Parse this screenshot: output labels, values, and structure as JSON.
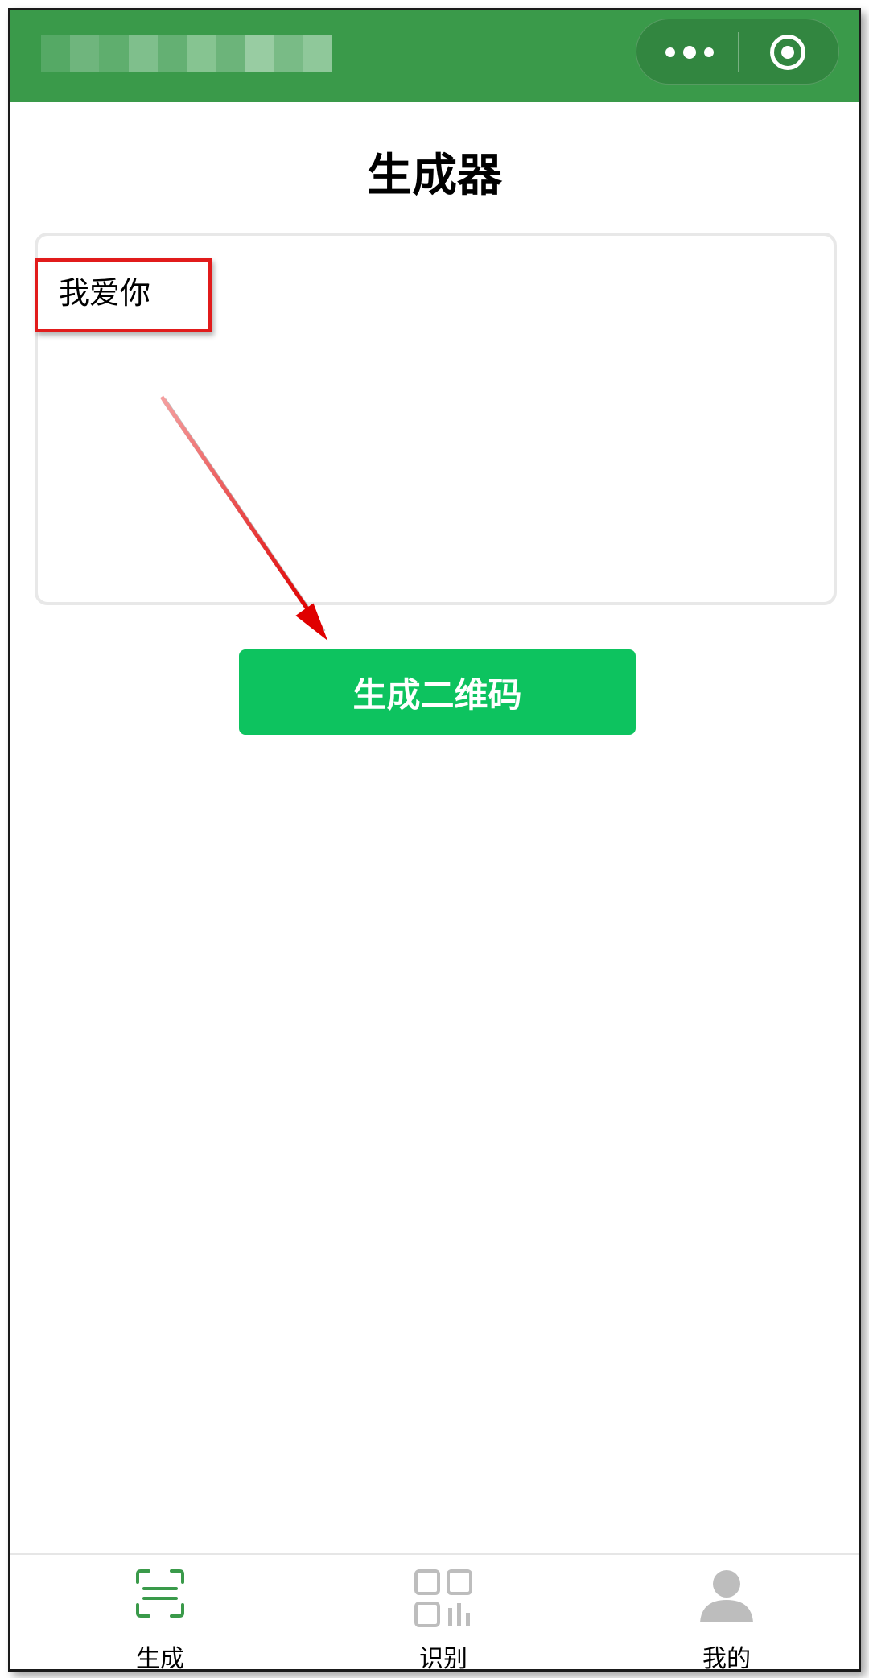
{
  "navbar": {
    "title_blurred": "",
    "more_icon": "more-dots-icon",
    "close_icon": "target-close-icon",
    "accent_color": "#3a9a4a"
  },
  "page": {
    "title": "生成器"
  },
  "input": {
    "value": "我爱你"
  },
  "generate_button": {
    "label": "生成二维码",
    "color": "#0dc35f"
  },
  "tabbar": {
    "items": [
      {
        "label": "生成",
        "icon": "scan-generate-icon",
        "active": true
      },
      {
        "label": "识别",
        "icon": "qrcode-grid-icon",
        "active": false
      },
      {
        "label": "我的",
        "icon": "user-avatar-icon",
        "active": false
      }
    ],
    "active_color": "#3a9a4a",
    "inactive_color": "#bdbdbd"
  },
  "annotation": {
    "color": "#e11b1b"
  }
}
